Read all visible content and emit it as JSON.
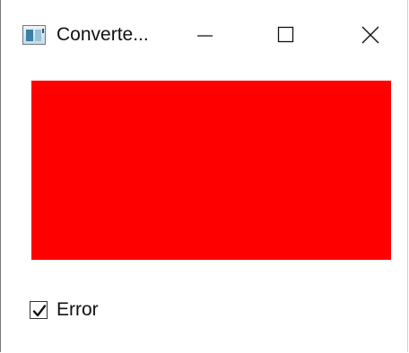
{
  "window": {
    "title": "Converte...",
    "icon": "app-window-icon"
  },
  "caption_buttons": {
    "minimize_icon": "minimize-icon",
    "maximize_icon": "maximize-icon",
    "close_icon": "close-icon"
  },
  "content": {
    "rect_color": "#ff0000",
    "checkbox": {
      "label": "Error",
      "checked": true
    }
  }
}
